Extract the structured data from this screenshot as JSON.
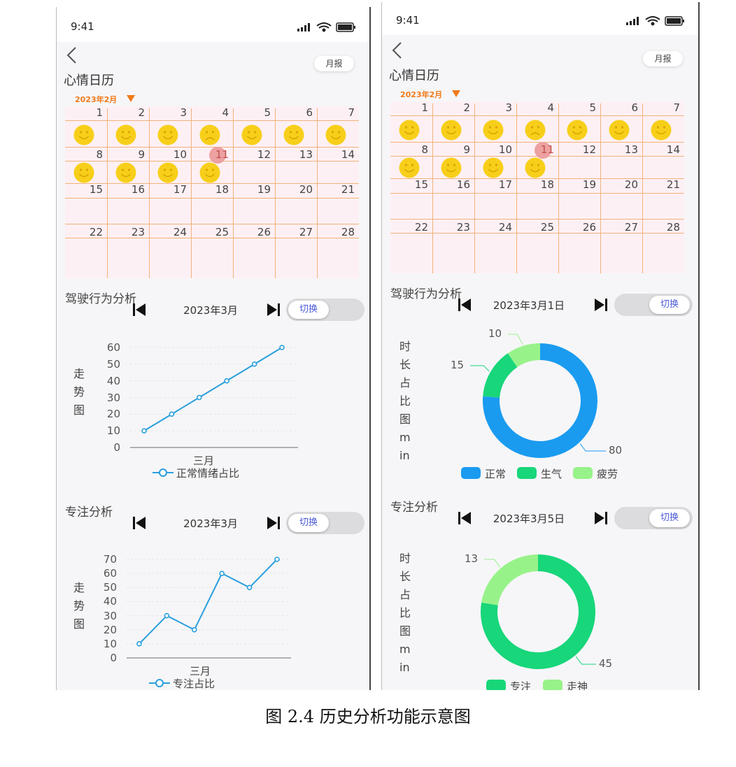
{
  "caption": "图 2.4  历史分析功能示意图",
  "colors": {
    "calendar_bg": "#fdf0f4",
    "grid_line": "#f0b27a",
    "month_accent": "#f07a1a",
    "mood": "#f7cf1a",
    "highlight": "#eda1a1",
    "line": "#2a9fdc",
    "blue": "#1a9bf0",
    "green": "#18d67a",
    "light_green": "#98f28a",
    "toggle_text": "#4a5ad8"
  },
  "phones": [
    {
      "status_time": "9:41",
      "monthly_report_label": "月报",
      "calendar": {
        "title": "心情日历",
        "month": "2023年2月",
        "days": [
          1,
          2,
          3,
          4,
          5,
          6,
          7,
          8,
          9,
          10,
          11,
          12,
          13,
          14,
          15,
          16,
          17,
          18,
          19,
          20,
          21,
          22,
          23,
          24,
          25,
          26,
          27,
          28
        ],
        "highlighted_day": 11,
        "moods": [
          "happy",
          "happy",
          "happy",
          "sad",
          "happy",
          "happy",
          "happy",
          "happy",
          "happy",
          "happy",
          "happy"
        ]
      },
      "driving": {
        "title": "驾驶行为分析",
        "period": "2023年3月",
        "toggle_label": "切换",
        "toggle_position": "left"
      },
      "focus": {
        "title": "专注分析",
        "period": "2023年3月",
        "toggle_label": "切换",
        "toggle_position": "left"
      }
    },
    {
      "status_time": "9:41",
      "monthly_report_label": "月报",
      "calendar": {
        "title": "心情日历",
        "month": "2023年2月",
        "days": [
          1,
          2,
          3,
          4,
          5,
          6,
          7,
          8,
          9,
          10,
          11,
          12,
          13,
          14,
          15,
          16,
          17,
          18,
          19,
          20,
          21,
          22,
          23,
          24,
          25,
          26,
          27,
          28
        ],
        "highlighted_day": 11,
        "moods": [
          "happy",
          "happy",
          "happy",
          "sad",
          "happy",
          "happy",
          "happy",
          "happy",
          "happy",
          "happy",
          "happy"
        ]
      },
      "driving": {
        "title": "驾驶行为分析",
        "period": "2023年3月1日",
        "toggle_label": "切换",
        "toggle_position": "right"
      },
      "focus": {
        "title": "专注分析",
        "period": "2023年3月5日",
        "toggle_label": "切换",
        "toggle_position": "right"
      }
    }
  ],
  "chart_data": [
    {
      "type": "line",
      "ylabel": "走势图",
      "xlabel": "三月",
      "ylim": [
        0,
        60
      ],
      "yticks": [
        "0",
        "10",
        "20",
        "30",
        "40",
        "50",
        "60"
      ],
      "series": [
        {
          "name": "正常情绪占比",
          "values": [
            10,
            20,
            30,
            40,
            50,
            60
          ]
        }
      ],
      "grid": true,
      "legend": "bottom"
    },
    {
      "type": "line",
      "ylabel": "走势图",
      "xlabel": "三月",
      "ylim": [
        0,
        70
      ],
      "yticks": [
        "0",
        "10",
        "20",
        "30",
        "40",
        "50",
        "60",
        "70"
      ],
      "series": [
        {
          "name": "专注占比",
          "values": [
            10,
            30,
            20,
            60,
            50,
            70
          ]
        }
      ],
      "grid": true,
      "legend": "bottom"
    },
    {
      "type": "pie",
      "donut": true,
      "ylabel": "时长占比图min",
      "categories": [
        "正常",
        "生气",
        "疲劳"
      ],
      "values": [
        80,
        15,
        10
      ],
      "labels": [
        "80",
        "15",
        "10"
      ],
      "colors": [
        "#1a9bf0",
        "#18d67a",
        "#98f28a"
      ],
      "legend": "bottom"
    },
    {
      "type": "pie",
      "donut": true,
      "ylabel": "时长占比图min",
      "categories": [
        "专注",
        "走神"
      ],
      "values": [
        45,
        13
      ],
      "labels": [
        "45",
        "13"
      ],
      "colors": [
        "#18d67a",
        "#98f28a"
      ],
      "legend": "bottom"
    }
  ]
}
